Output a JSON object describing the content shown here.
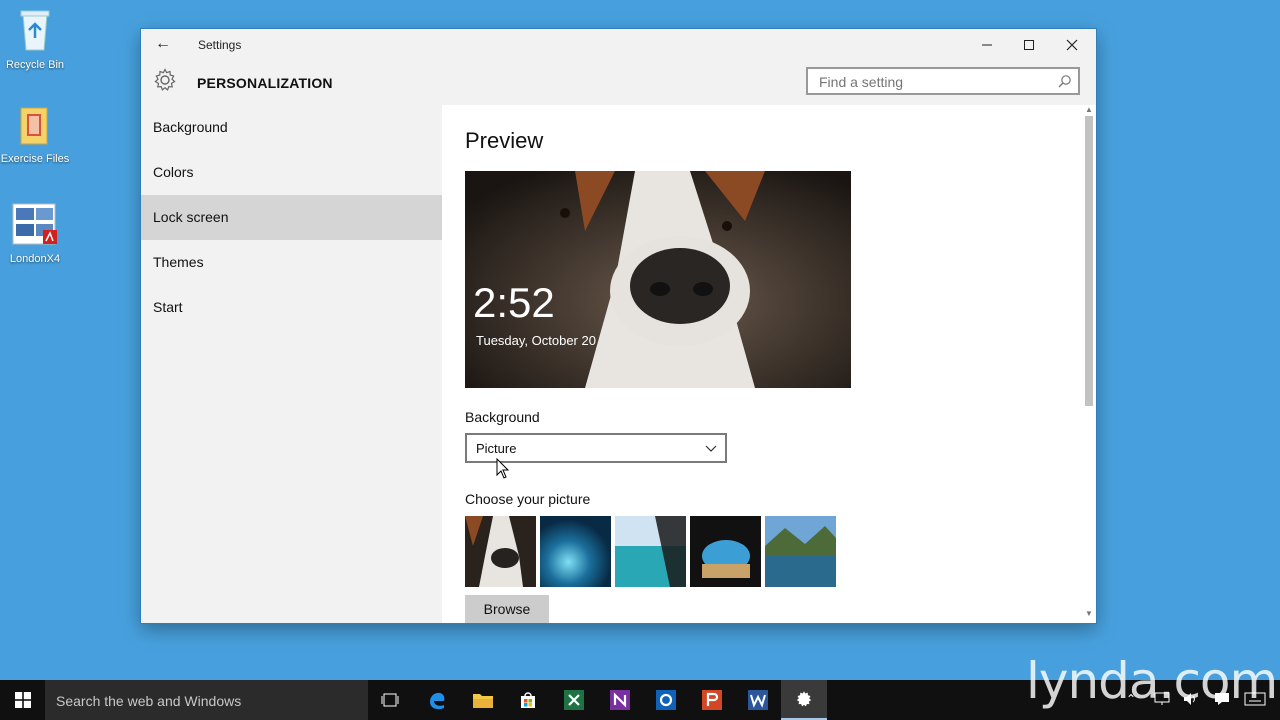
{
  "desktop": {
    "icons": [
      {
        "label": "Recycle Bin"
      },
      {
        "label": "Exercise Files"
      },
      {
        "label": "LondonX4"
      }
    ]
  },
  "window": {
    "title": "Settings",
    "page_title": "PERSONALIZATION",
    "search_placeholder": "Find a setting"
  },
  "sidebar": {
    "items": [
      {
        "label": "Background",
        "selected": false
      },
      {
        "label": "Colors",
        "selected": false
      },
      {
        "label": "Lock screen",
        "selected": true
      },
      {
        "label": "Themes",
        "selected": false
      },
      {
        "label": "Start",
        "selected": false
      }
    ]
  },
  "content": {
    "preview_heading": "Preview",
    "preview_time": "2:52",
    "preview_date": "Tuesday, October 20",
    "background_label": "Background",
    "background_value": "Picture",
    "choose_label": "Choose your picture",
    "browse_label": "Browse"
  },
  "taskbar": {
    "search_placeholder": "Search the web and Windows"
  },
  "watermark": "lynda.com",
  "colors": {
    "desktop": "#47a0dd",
    "accent": "#0078d7",
    "selected_nav": "#d5d5d5"
  }
}
